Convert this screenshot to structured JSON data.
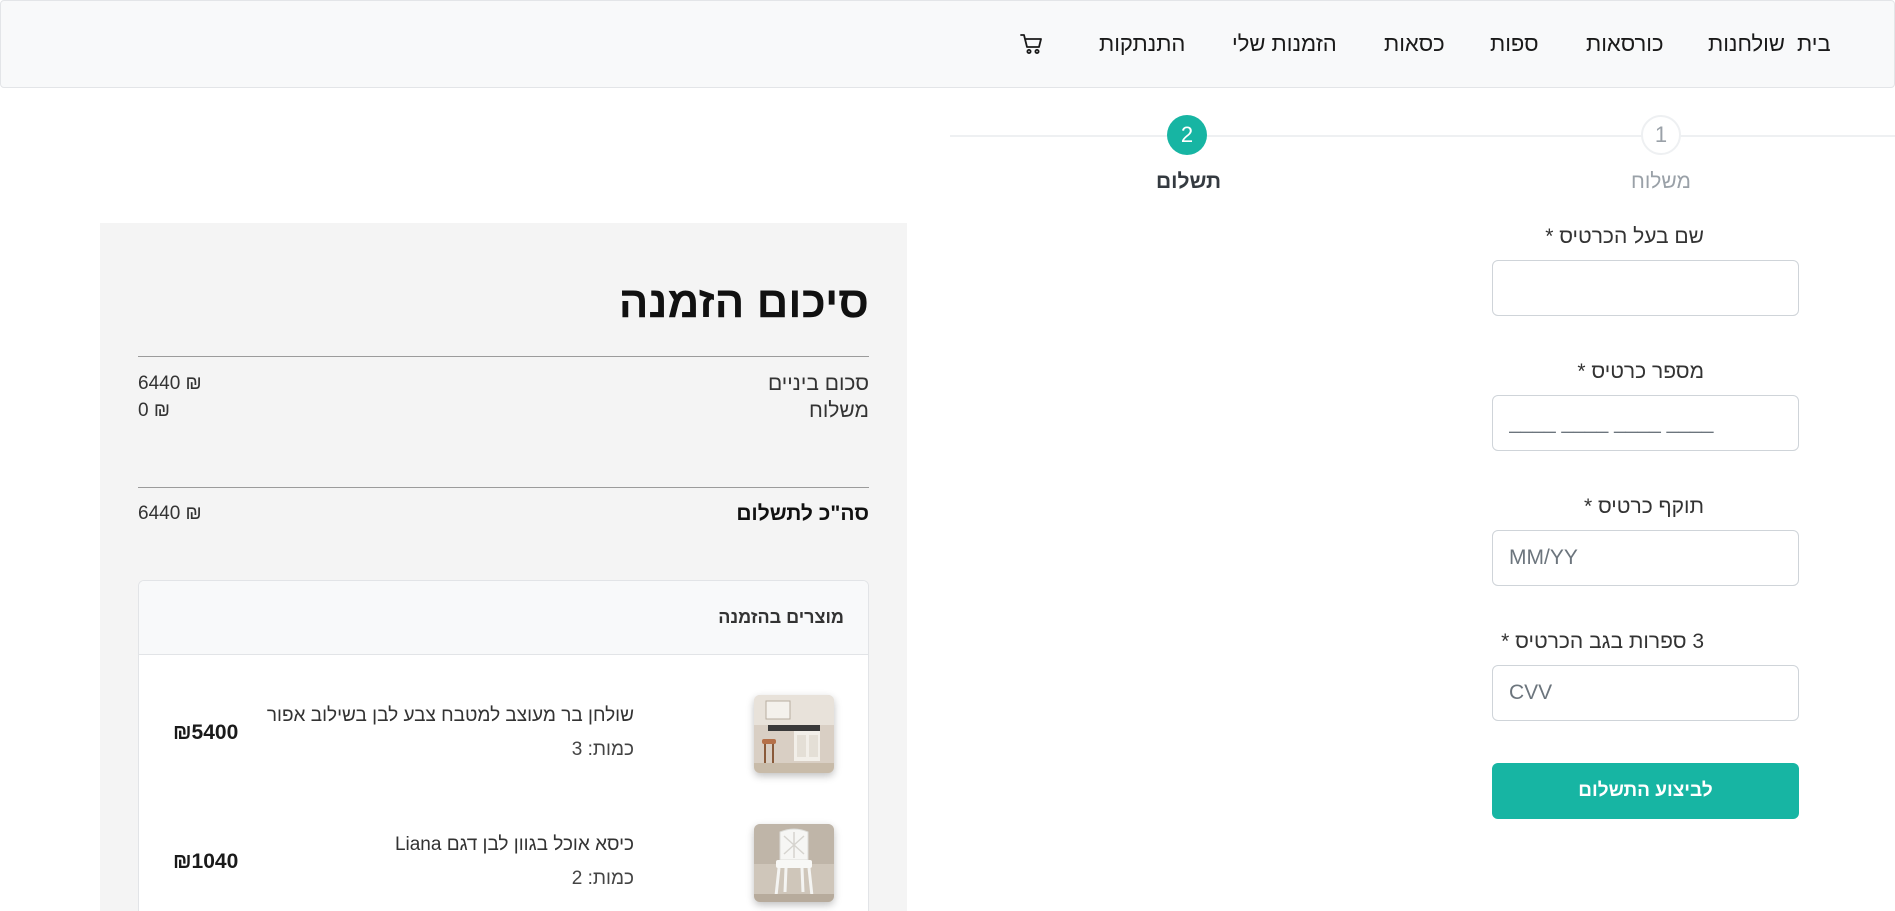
{
  "navbar": {
    "links": [
      "בית",
      "שולחנות",
      "כורסאות",
      "ספות",
      "כסאות",
      "הזמנות שלי",
      "התנתקות"
    ],
    "cart_icon": "cart-icon"
  },
  "stepper": {
    "steps": [
      {
        "number": "1",
        "label": "משלוח",
        "state": "completed"
      },
      {
        "number": "2",
        "label": "תשלום",
        "state": "active"
      }
    ],
    "active_color": "#17b5a3"
  },
  "payment_form": {
    "card_holder": {
      "label": "שם בעל הכרטיס *",
      "value": "",
      "placeholder": ""
    },
    "card_number": {
      "label": "מספר כרטיס *",
      "value": "",
      "placeholder": "____ ____ ____ ____"
    },
    "expiry": {
      "label": "תוקף כרטיס *",
      "value": "",
      "placeholder": "MM/YY"
    },
    "cvv": {
      "label": "3 ספרות בגב הכרטיס *",
      "value": "",
      "placeholder": "CVV"
    },
    "submit_label": "לביצוע התשלום"
  },
  "summary": {
    "title": "סיכום הזמנה",
    "subtotal": {
      "label": "סכום ביניים",
      "value": "6440 ₪"
    },
    "shipping": {
      "label": "משלוח",
      "value": "0 ₪"
    },
    "total": {
      "label": "סה\"כ לתשלום",
      "value": "6440 ₪"
    },
    "items_header": "מוצרים בהזמנה",
    "items": [
      {
        "name": "שולחן בר מעוצב למטבח צבע לבן בשילוב אפור",
        "quantity": "כמות: 3",
        "price": "₪5400",
        "image_icon": "bar-table-image"
      },
      {
        "name": "כיסא אוכל בגוון לבן דגם Liana",
        "quantity": "כמות: 2",
        "price": "₪1040",
        "image_icon": "white-chair-image"
      }
    ]
  }
}
